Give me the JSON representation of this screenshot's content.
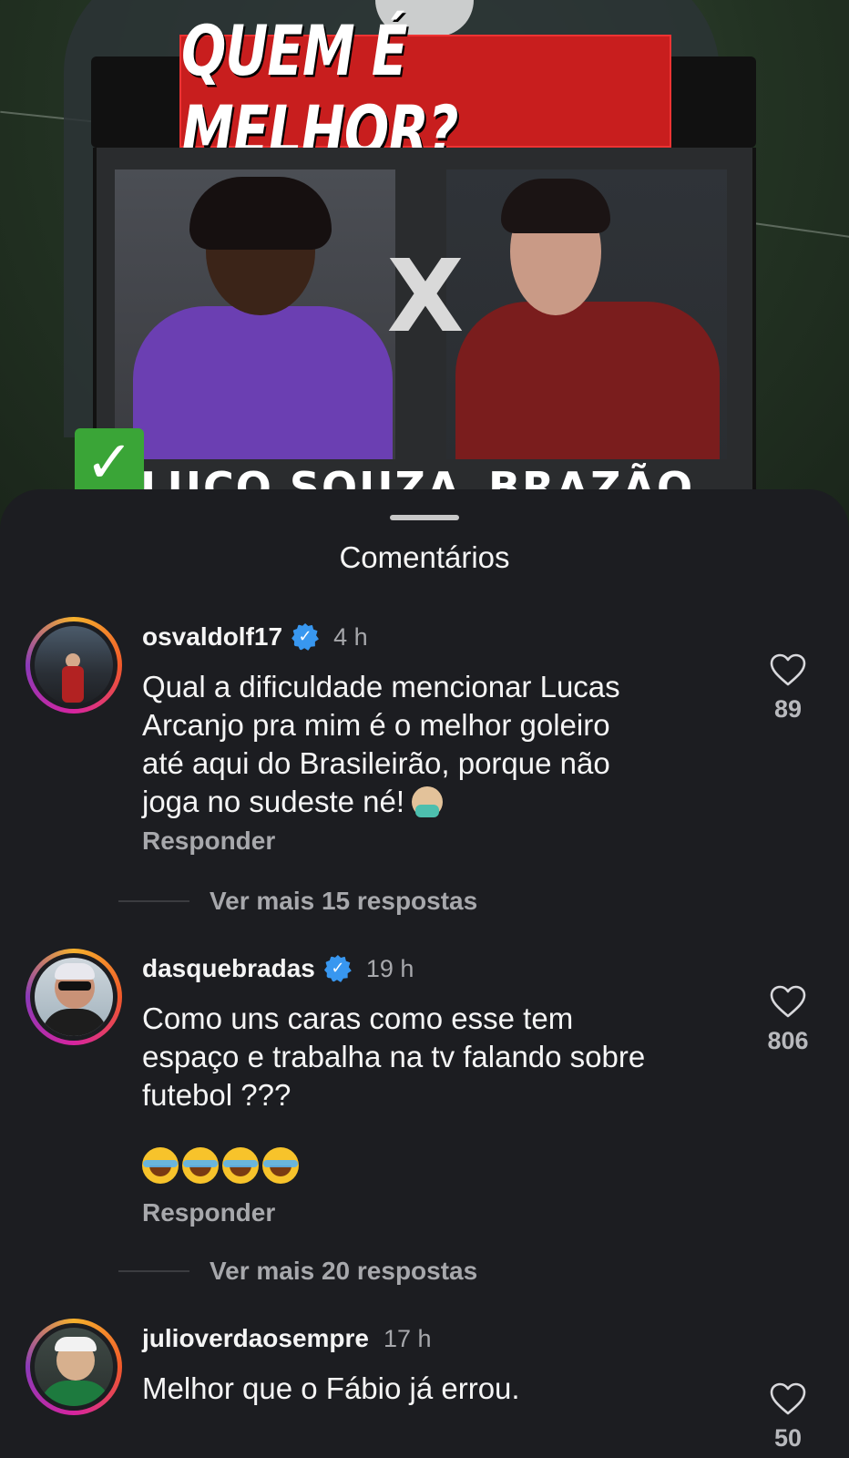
{
  "post": {
    "banner_title": "QUEM É MELHOR?",
    "versus": "X",
    "player_left_name": "LUCO SOUZA",
    "player_right_name": "BRAZÃO",
    "check_symbol": "✓"
  },
  "sheet": {
    "title": "Comentários"
  },
  "comments": [
    {
      "username": "osvaldolf17",
      "verified": true,
      "time": "4 h",
      "text": "Qual a dificuldade mencionar Lucas\nArcanjo pra mim é o melhor goleiro\naté aqui do Brasileirão, porque não\njoga no sudeste né!",
      "text_emoji": "facepalm-emoji",
      "reply_label": "Responder",
      "likes": "89",
      "more_replies": "Ver mais 15 respostas"
    },
    {
      "username": "dasquebradas",
      "verified": true,
      "time": "19 h",
      "text": "Como uns caras como esse tem\nespaço e trabalha na tv falando sobre\nfutebol ???",
      "text_emoji": "laughing-emoji x4",
      "reply_label": "Responder",
      "likes": "806",
      "more_replies": "Ver mais 20 respostas"
    },
    {
      "username": "julioverdaosempre",
      "verified": false,
      "time": "17 h",
      "text": "Melhor que o Fábio já errou.",
      "likes": "50"
    }
  ],
  "icons": {
    "like": "heart-outline-icon",
    "verified": "verified-badge-icon"
  },
  "colors": {
    "background": "#1c1d21",
    "verified": "#3897f0",
    "banner_red": "#c81e1e",
    "muted_text": "#a7a8ac"
  }
}
